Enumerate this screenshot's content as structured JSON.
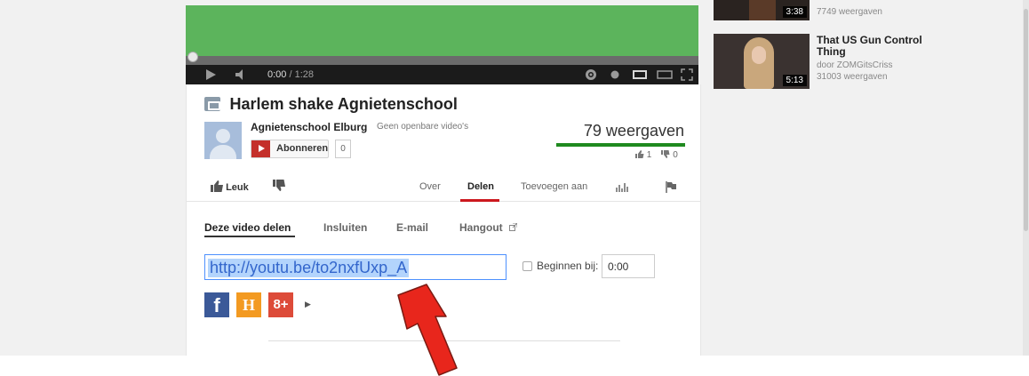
{
  "player": {
    "time_current": "0:00",
    "time_sep": " / ",
    "time_total": "1:28",
    "progress_fraction": 0.0
  },
  "video": {
    "title": "Harlem shake Agnietenschool",
    "channel": "Agnietenschool Elburg",
    "channel_sep": "·",
    "channel_note": "Geen openbare video's",
    "subscribe_label": "Abonneren",
    "subscriber_count": "0",
    "views": "79 weergaven",
    "likes": "1",
    "dislikes": "0",
    "like_ratio": 1.0
  },
  "actions": {
    "like_label": "Leuk",
    "tabs": [
      "Over",
      "Delen",
      "Toevoegen aan"
    ],
    "active_tab": "Delen"
  },
  "share": {
    "subtabs": [
      "Deze video delen",
      "Insluiten",
      "E-mail",
      "Hangout"
    ],
    "active_subtab": "Deze video delen",
    "url": "http://youtu.be/to2nxfUxp_A",
    "start_label": "Beginnen bij:",
    "start_time": "0:00",
    "social": [
      {
        "name": "facebook",
        "glyph": "f",
        "color": "#3b5998"
      },
      {
        "name": "hyves",
        "glyph": "H",
        "color": "#f39a21"
      },
      {
        "name": "google-plus",
        "glyph": "8+",
        "color": "#dd4b39"
      }
    ]
  },
  "sidebar": {
    "items": [
      {
        "title": "",
        "author": "",
        "views": "7749 weergaven",
        "duration": "3:38"
      },
      {
        "title": "That US Gun Control Thing",
        "author": "door ZOMGitsCriss",
        "views": "31003 weergaven",
        "duration": "5:13"
      }
    ]
  },
  "colors": {
    "accent_red": "#cc181e",
    "arrow_red": "#e8261c",
    "video_green": "#5cb45c",
    "views_bar": "#1f8a1f"
  }
}
